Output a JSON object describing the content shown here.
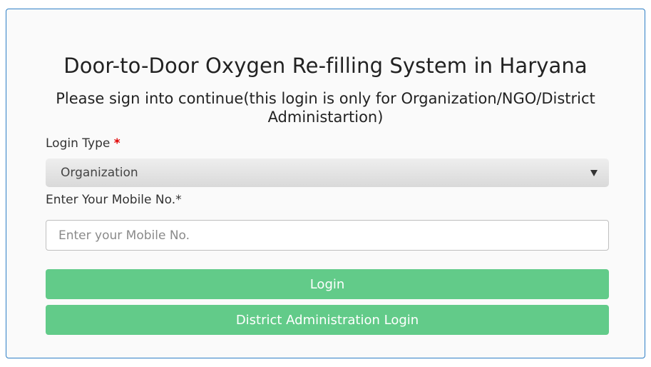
{
  "page": {
    "title": "Door-to-Door Oxygen Re-filling System in Haryana",
    "subtitle": "Please sign into continue(this login is only for Organization/NGO/District Administartion)"
  },
  "form": {
    "login_type_label": "Login Type",
    "login_type_required_mark": "*",
    "login_type_selected": "Organization",
    "mobile_label": "Enter Your Mobile No.*",
    "mobile_placeholder": "Enter your Mobile No.",
    "mobile_value": ""
  },
  "buttons": {
    "login_label": "Login",
    "district_login_label": "District Administration Login"
  },
  "icons": {
    "select_caret": "caret-down-icon"
  },
  "colors": {
    "card_border": "#2f7fc6",
    "button_bg": "#62cb89",
    "required_mark": "#e10000"
  }
}
